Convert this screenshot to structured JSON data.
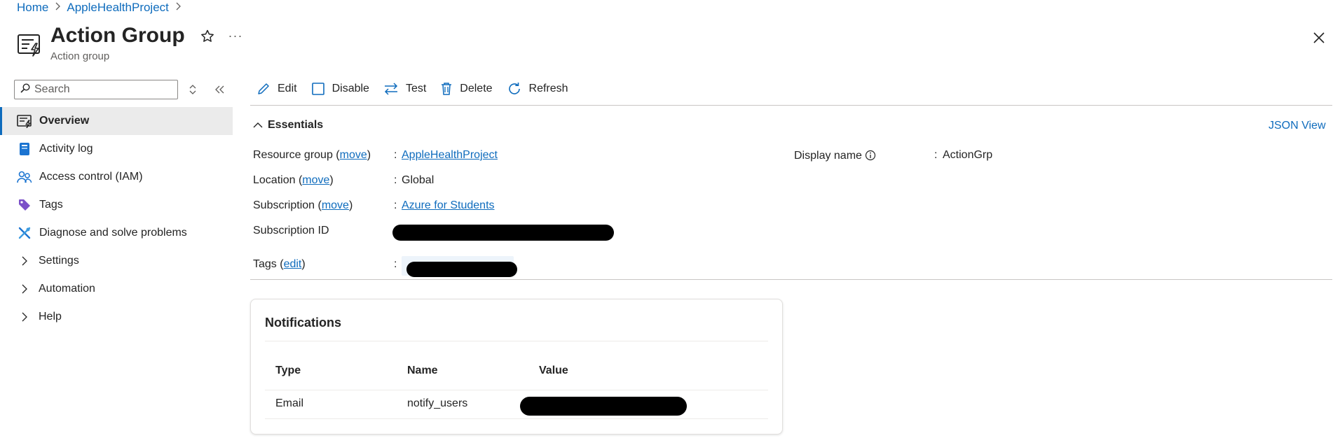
{
  "breadcrumb": {
    "home": "Home",
    "project": "AppleHealthProject"
  },
  "header": {
    "title": "Action Group",
    "subtitle": "Action group",
    "icons": {
      "resource": "action-group-icon",
      "favorite": "star-icon",
      "more": "ellipsis-icon",
      "close": "close-icon"
    }
  },
  "sidebar": {
    "search_placeholder": "Search",
    "items": [
      {
        "label": "Overview",
        "icon": "overview-icon",
        "selected": true
      },
      {
        "label": "Activity log",
        "icon": "activity-log-icon"
      },
      {
        "label": "Access control (IAM)",
        "icon": "people-icon"
      },
      {
        "label": "Tags",
        "icon": "tag-icon"
      },
      {
        "label": "Diagnose and solve problems",
        "icon": "wrench-icon"
      },
      {
        "label": "Settings",
        "icon": "chevron-right-icon"
      },
      {
        "label": "Automation",
        "icon": "chevron-right-icon"
      },
      {
        "label": "Help",
        "icon": "chevron-right-icon"
      }
    ]
  },
  "toolbar": {
    "edit": "Edit",
    "disable": "Disable",
    "test": "Test",
    "delete": "Delete",
    "refresh": "Refresh"
  },
  "essentials": {
    "title": "Essentials",
    "json_view": "JSON View",
    "move": "move",
    "edit": "edit",
    "colon": ":",
    "resource_group_label": "Resource group",
    "resource_group_value": "AppleHealthProject",
    "location_label": "Location",
    "location_value": "Global",
    "subscription_label": "Subscription",
    "subscription_value": "Azure for Students",
    "subscription_id_label": "Subscription ID",
    "tags_label": "Tags",
    "display_name_label": "Display name",
    "display_name_value": "ActionGrp"
  },
  "notifications": {
    "title": "Notifications",
    "columns": [
      "Type",
      "Name",
      "Value"
    ],
    "rows": [
      {
        "type": "Email",
        "name": "notify_users"
      }
    ]
  },
  "colors": {
    "accent": "#0f6cbd",
    "text": "#242424",
    "muted": "#605e5c",
    "selected_bg": "#ebebeb"
  }
}
